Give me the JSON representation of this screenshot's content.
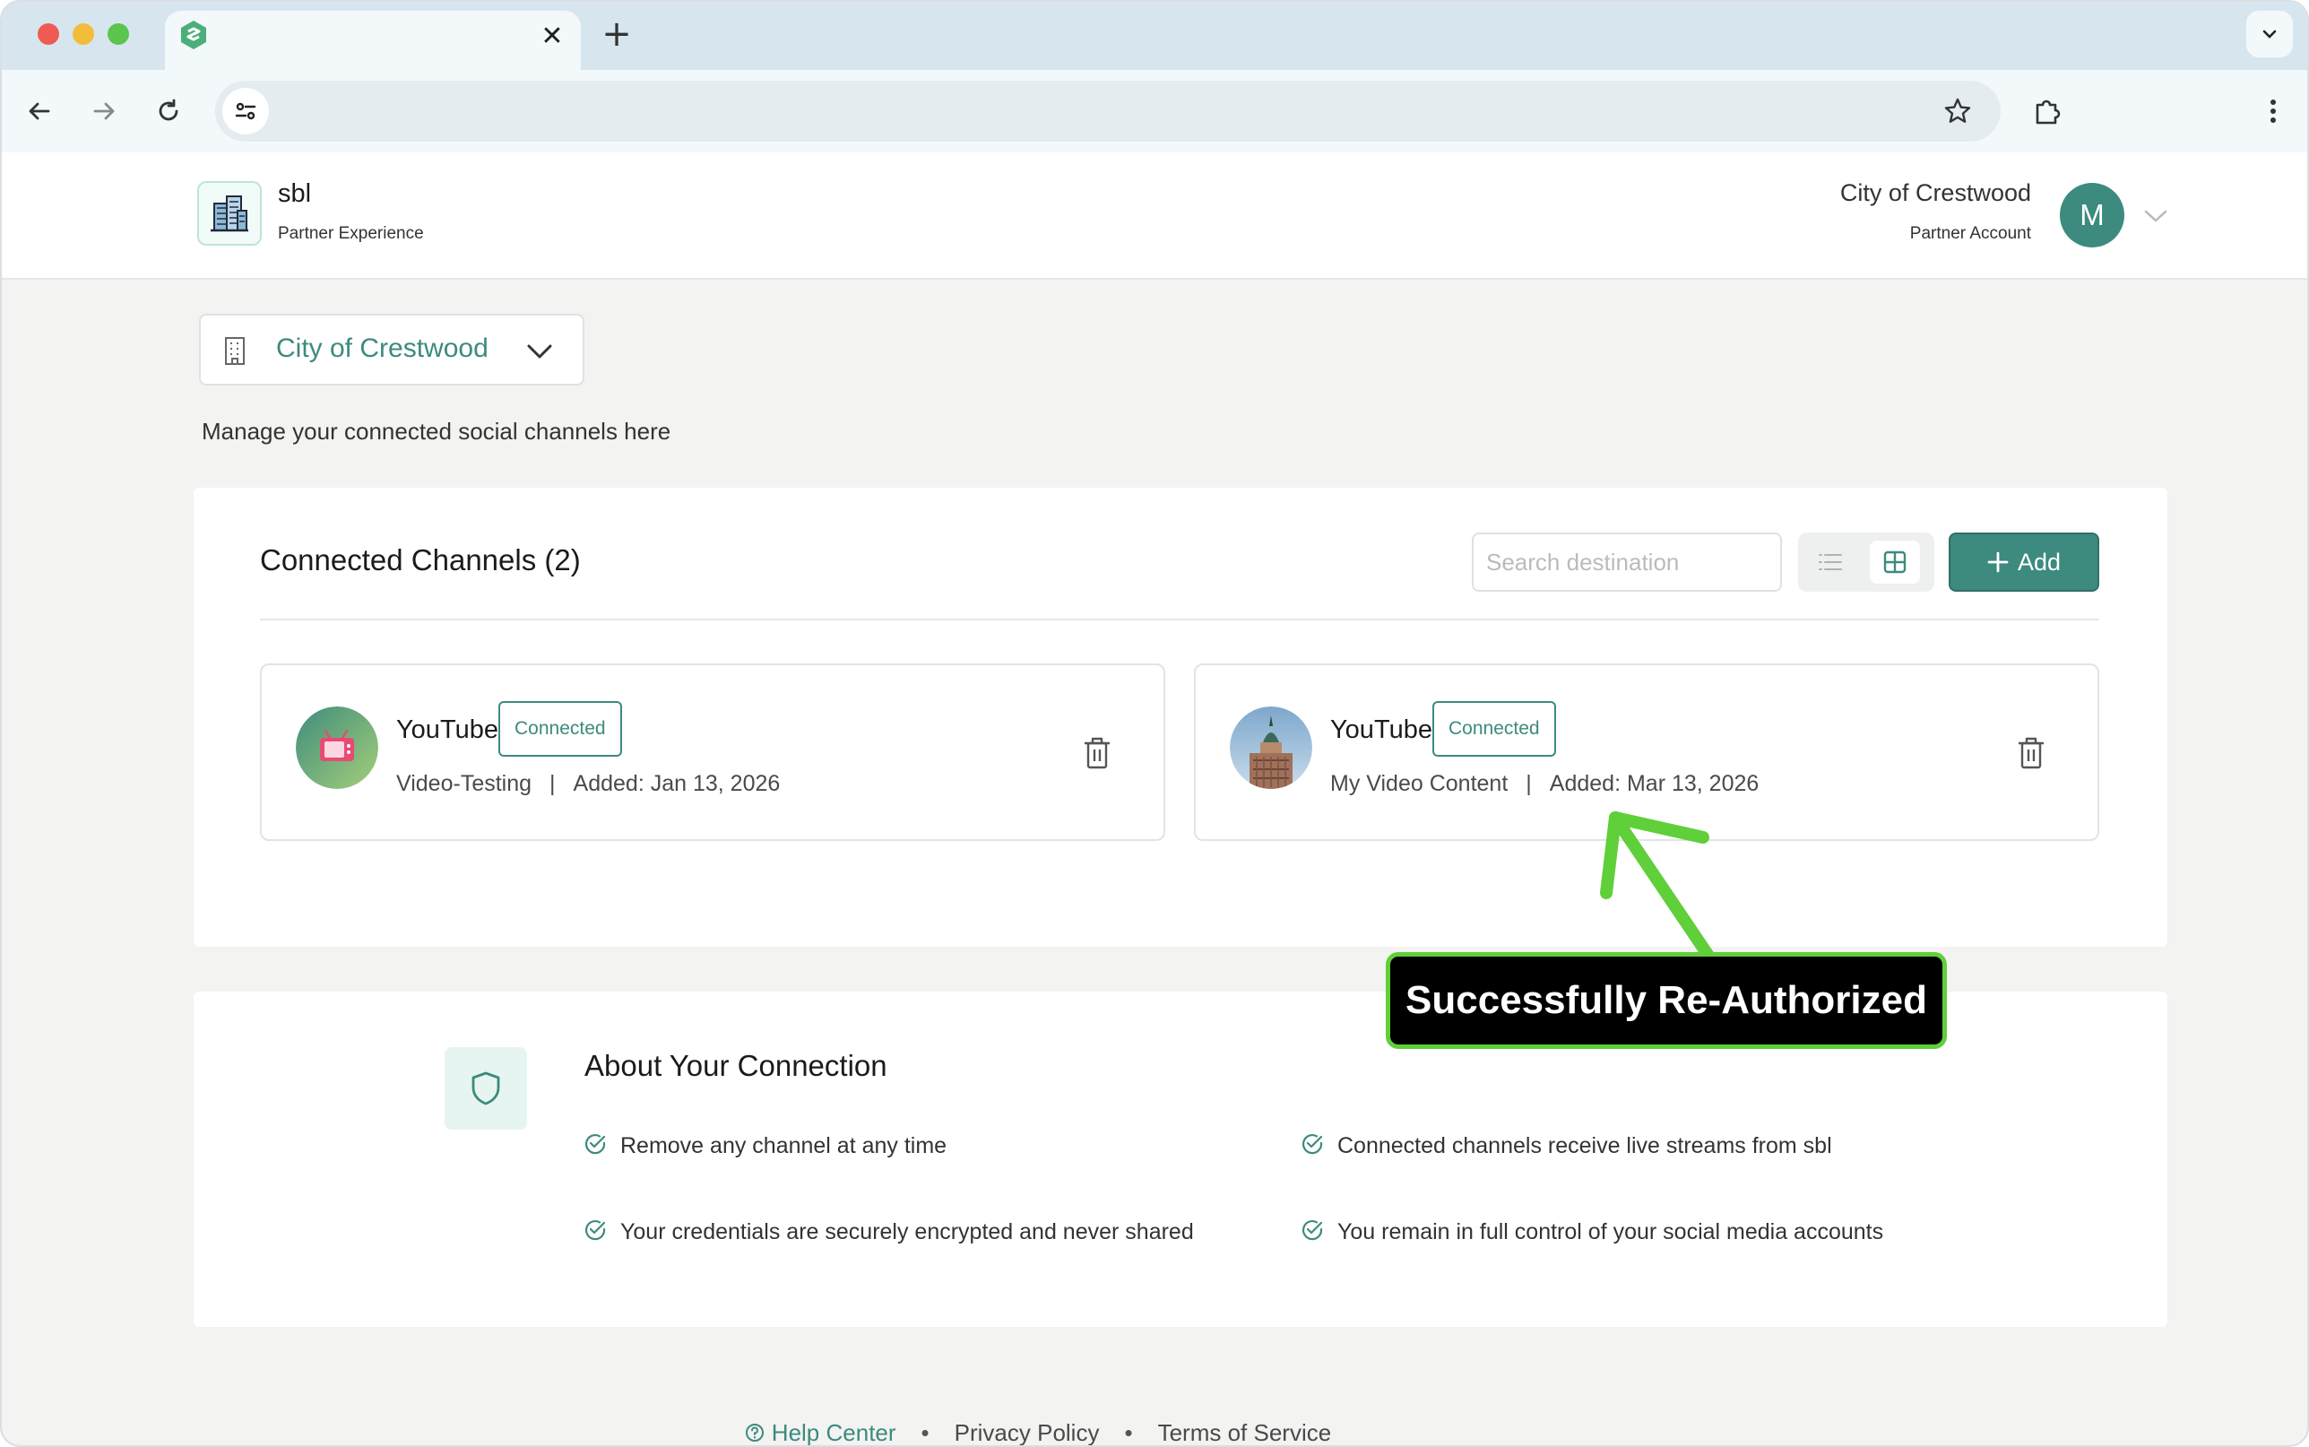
{
  "browser": {
    "tab_close_glyph": "✕",
    "new_tab_glyph": "+"
  },
  "header": {
    "brand_name": "sbl",
    "brand_subtitle": "Partner Experience",
    "account_name": "City of Crestwood",
    "account_subtitle": "Partner Account",
    "avatar_initial": "M"
  },
  "org_selector": {
    "selected": "City of Crestwood"
  },
  "intro_text": "Manage your connected social channels here",
  "channels": {
    "title": "Connected Channels (2)",
    "search_placeholder": "Search destination",
    "add_label": "Add",
    "items": [
      {
        "platform": "YouTube",
        "status": "Connected",
        "name": "Video-Testing",
        "separator": "|",
        "added": "Added: Jan 13, 2026"
      },
      {
        "platform": "YouTube",
        "status": "Connected",
        "name": "My Video Content",
        "separator": "|",
        "added": "Added: Mar 13, 2026"
      }
    ]
  },
  "about": {
    "title": "About Your Connection",
    "features": [
      "Remove any channel at any time",
      "Connected channels receive live streams from sbl",
      "Your credentials are securely encrypted and never shared",
      "You remain in full control of your social media accounts"
    ]
  },
  "annotation": {
    "text": "Successfully Re-Authorized"
  },
  "footer": {
    "help": "Help Center",
    "privacy": "Privacy Policy",
    "terms": "Terms of Service",
    "separator": "•"
  },
  "colors": {
    "accent": "#3d8a7e",
    "annotation_border": "#5fcf3a"
  }
}
